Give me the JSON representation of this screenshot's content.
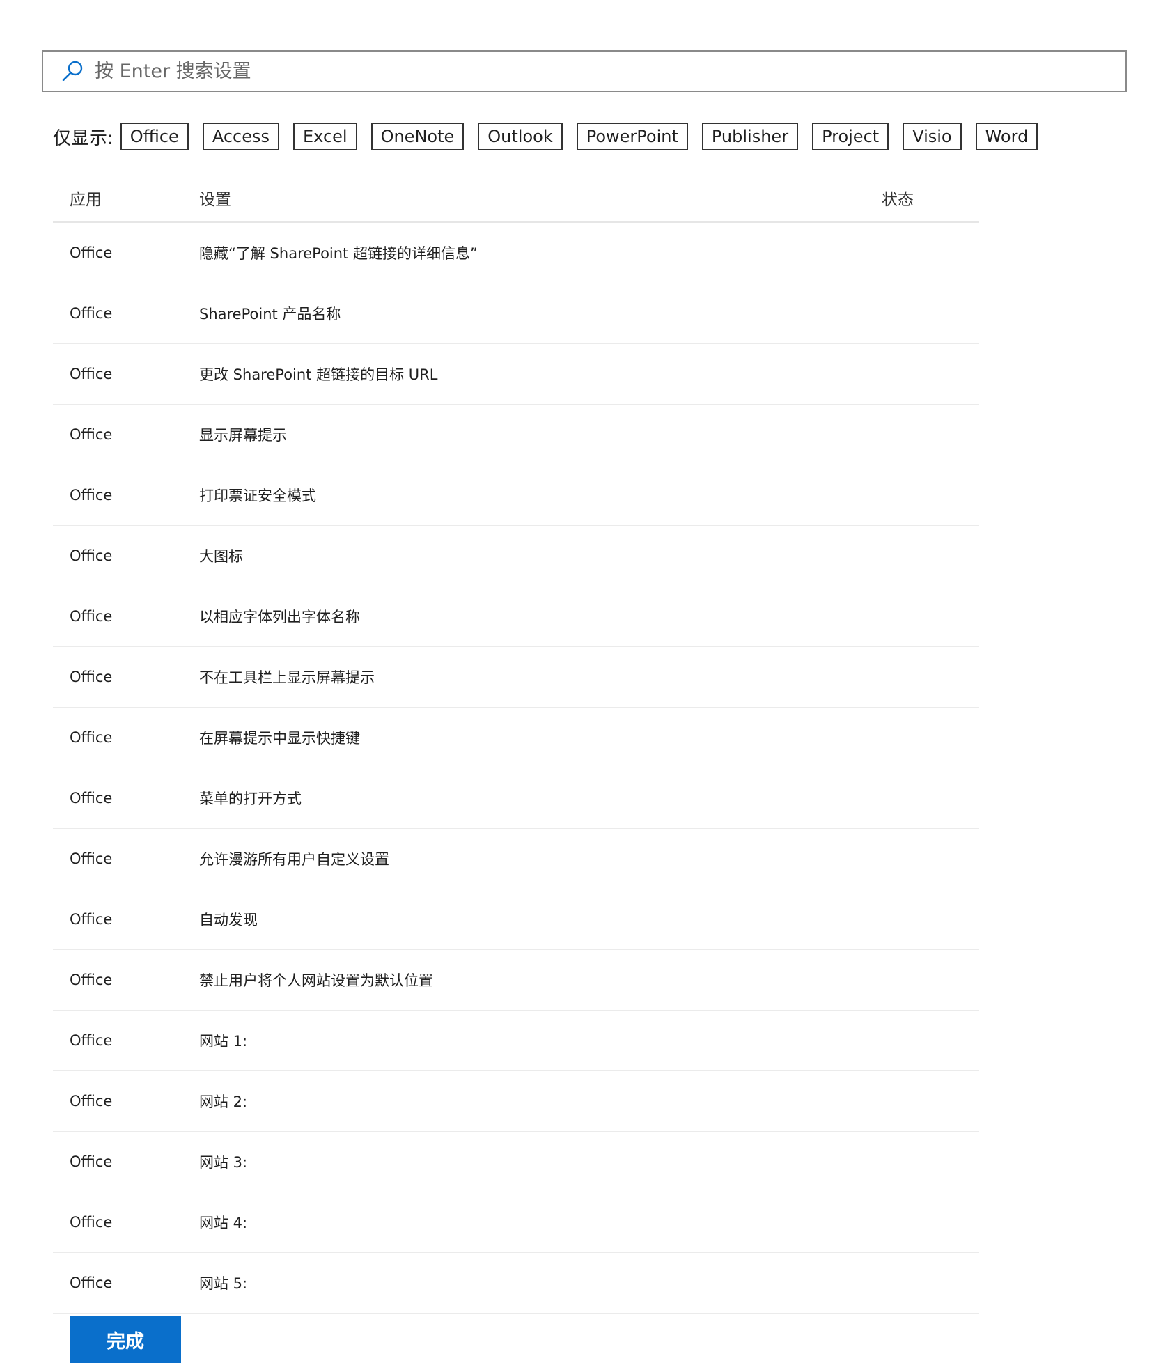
{
  "search": {
    "placeholder": "按 Enter 搜索设置"
  },
  "filters": {
    "label": "仅显示:",
    "options": [
      "Office",
      "Access",
      "Excel",
      "OneNote",
      "Outlook",
      "PowerPoint",
      "Publisher",
      "Project",
      "Visio",
      "Word"
    ]
  },
  "table": {
    "headers": {
      "app": "应用",
      "setting": "设置",
      "status": "状态"
    },
    "rows": [
      {
        "app": "Office",
        "setting": "隐藏“了解 SharePoint 超链接的详细信息”",
        "status": ""
      },
      {
        "app": "Office",
        "setting": "SharePoint 产品名称",
        "status": ""
      },
      {
        "app": "Office",
        "setting": "更改 SharePoint 超链接的目标 URL",
        "status": ""
      },
      {
        "app": "Office",
        "setting": "显示屏幕提示",
        "status": ""
      },
      {
        "app": "Office",
        "setting": "打印票证安全模式",
        "status": ""
      },
      {
        "app": "Office",
        "setting": "大图标",
        "status": ""
      },
      {
        "app": "Office",
        "setting": "以相应字体列出字体名称",
        "status": ""
      },
      {
        "app": "Office",
        "setting": "不在工具栏上显示屏幕提示",
        "status": ""
      },
      {
        "app": "Office",
        "setting": "在屏幕提示中显示快捷键",
        "status": ""
      },
      {
        "app": "Office",
        "setting": "菜单的打开方式",
        "status": ""
      },
      {
        "app": "Office",
        "setting": "允许漫游所有用户自定义设置",
        "status": ""
      },
      {
        "app": "Office",
        "setting": "自动发现",
        "status": ""
      },
      {
        "app": "Office",
        "setting": "禁止用户将个人网站设置为默认位置",
        "status": ""
      },
      {
        "app": "Office",
        "setting": "网站 1:",
        "status": ""
      },
      {
        "app": "Office",
        "setting": "网站 2:",
        "status": ""
      },
      {
        "app": "Office",
        "setting": "网站 3:",
        "status": ""
      },
      {
        "app": "Office",
        "setting": "网站 4:",
        "status": ""
      },
      {
        "app": "Office",
        "setting": "网站 5:",
        "status": ""
      }
    ]
  },
  "actions": {
    "done_label": "完成"
  },
  "colors": {
    "accent": "#0a6fcb",
    "search_icon": "#0a6fcb",
    "border": "#8a8a8a",
    "divider": "#ebebeb"
  },
  "icons": {
    "search": "search-icon"
  }
}
